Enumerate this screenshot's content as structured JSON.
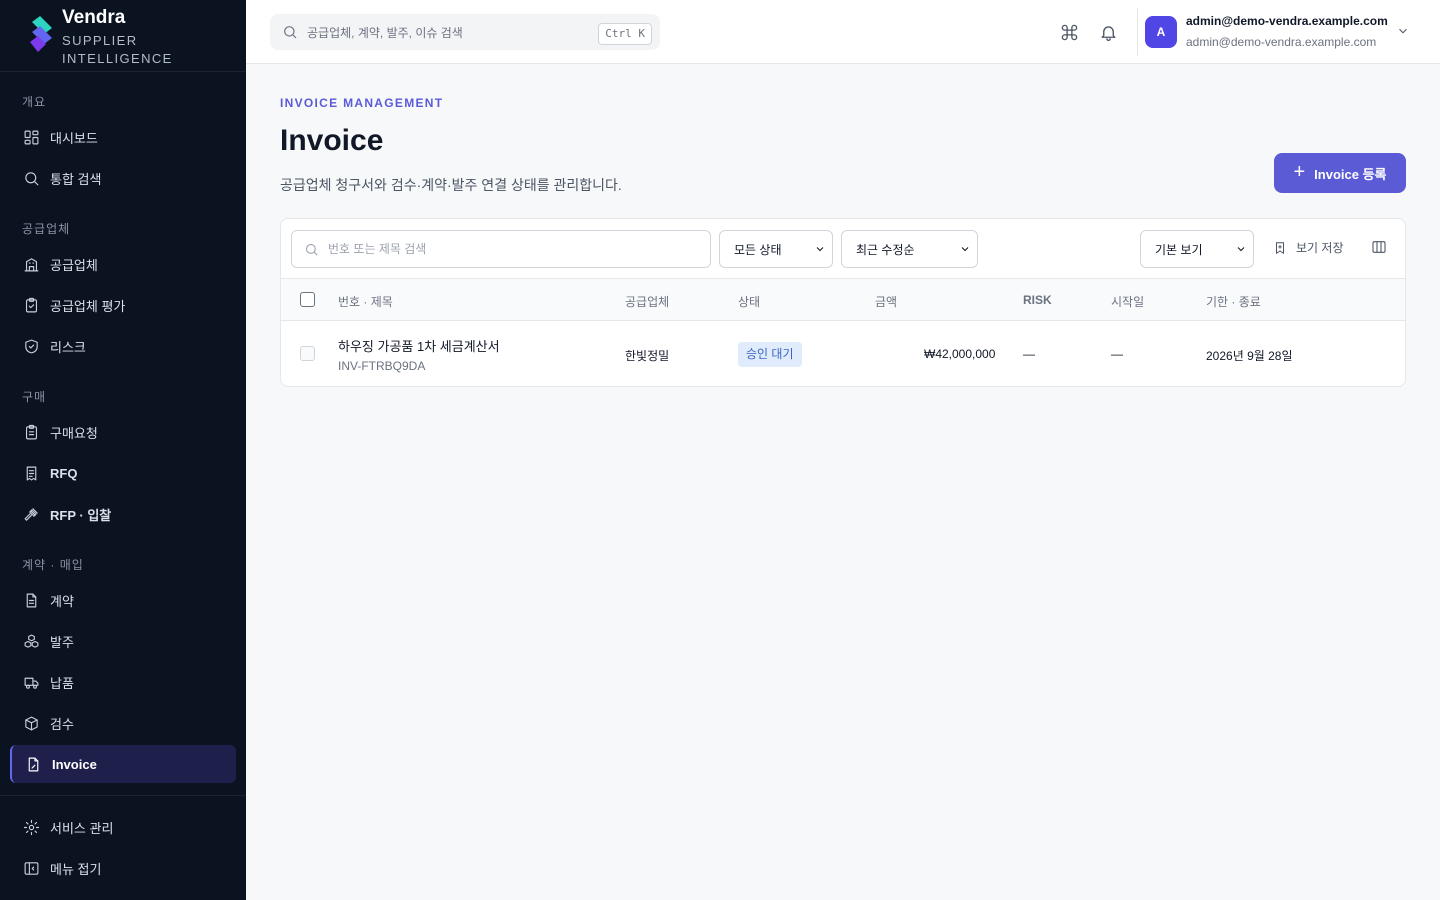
{
  "brand": {
    "name": "Vendra",
    "tagline": "SUPPLIER INTELLIGENCE"
  },
  "sidebar": {
    "groups": [
      {
        "label": "개요",
        "items": [
          {
            "label": "대시보드",
            "icon": "dashboard-icon"
          },
          {
            "label": "통합 검색",
            "icon": "search-icon"
          }
        ]
      },
      {
        "label": "공급업체",
        "items": [
          {
            "label": "공급업체",
            "icon": "building-icon"
          },
          {
            "label": "공급업체 평가",
            "icon": "clipboard-check-icon"
          },
          {
            "label": "리스크",
            "icon": "shield-icon"
          }
        ]
      },
      {
        "label": "구매",
        "items": [
          {
            "label": "구매요청",
            "icon": "clipboard-list-icon"
          },
          {
            "label": "RFQ",
            "icon": "receipt-icon"
          },
          {
            "label": "RFP · 입찰",
            "icon": "gavel-icon"
          }
        ]
      },
      {
        "label": "계약 · 매입",
        "items": [
          {
            "label": "계약",
            "icon": "file-text-icon"
          },
          {
            "label": "발주",
            "icon": "boxes-icon"
          },
          {
            "label": "납품",
            "icon": "truck-icon"
          },
          {
            "label": "검수",
            "icon": "package-check-icon"
          },
          {
            "label": "Invoice",
            "icon": "file-invoice-icon",
            "active": true
          }
        ]
      }
    ],
    "footer": [
      {
        "label": "서비스 관리",
        "icon": "gear-icon"
      },
      {
        "label": "메뉴 접기",
        "icon": "collapse-icon"
      }
    ]
  },
  "topbar": {
    "search_placeholder": "공급업체, 계약, 발주, 이슈 검색",
    "shortcut": "Ctrl K",
    "user": {
      "avatar_initial": "A",
      "name": "admin@demo-vendra.example.com",
      "email": "admin@demo-vendra.example.com"
    }
  },
  "page": {
    "eyebrow": "INVOICE MANAGEMENT",
    "title": "Invoice",
    "description": "공급업체 청구서와 검수·계약·발주 연결 상태를 관리합니다.",
    "primary_action": "Invoice 등록"
  },
  "filters": {
    "search_placeholder": "번호 또는 제목 검색",
    "status": "모든 상태",
    "sort": "최근 수정순",
    "view": "기본 보기",
    "save_view": "보기 저장"
  },
  "table": {
    "columns": {
      "number_title": "번호 · 제목",
      "supplier": "공급업체",
      "status": "상태",
      "amount": "금액",
      "risk": "RISK",
      "start": "시작일",
      "due": "기한 · 종료"
    },
    "rows": [
      {
        "title": "하우징 가공품 1차 세금계산서",
        "code": "INV-FTRBQ9DA",
        "supplier": "한빛정밀",
        "status": "승인 대기",
        "amount": "₩42,000,000",
        "risk": "—",
        "start": "—",
        "due": "2026년 9월 28일"
      }
    ]
  },
  "colors": {
    "accent": "#5b5bd6",
    "sidebar_bg": "#0b1220",
    "badge_bg": "#e0ecfb",
    "badge_text": "#3b64c8"
  }
}
